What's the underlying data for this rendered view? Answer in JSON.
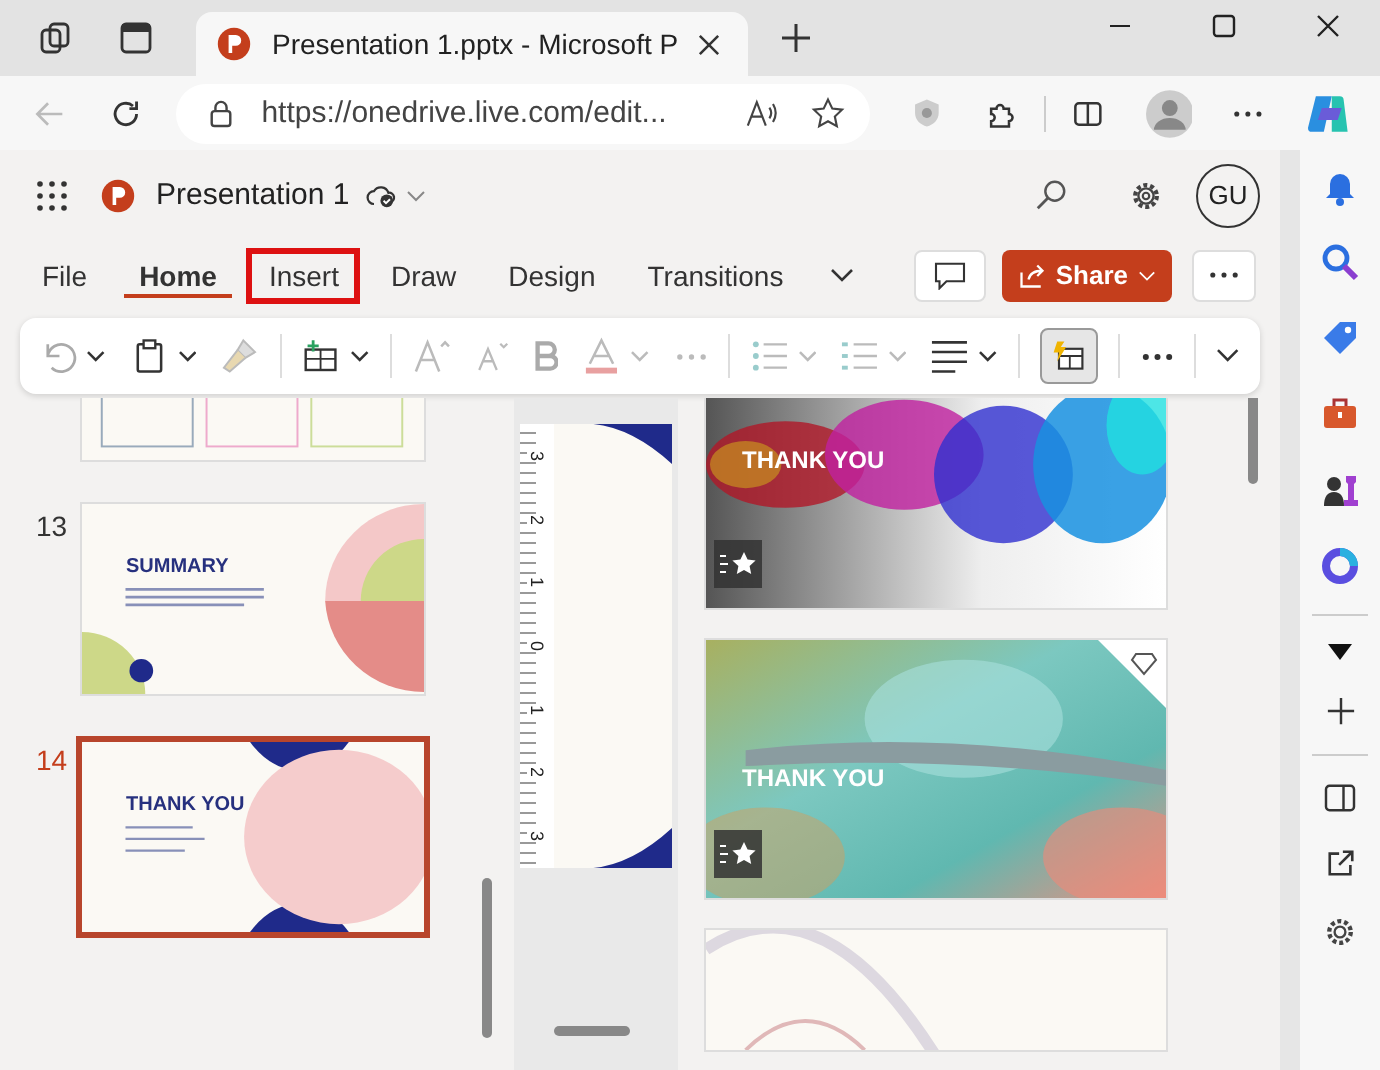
{
  "browser": {
    "tabs": [
      {
        "title": "Presentation 1.pptx - Microsoft P",
        "selected": true
      }
    ],
    "address": "https://onedrive.live.com/edit..."
  },
  "app": {
    "title": "Presentation 1",
    "avatar": "GU",
    "share": "Share"
  },
  "ribbon_tabs": [
    {
      "label": "File",
      "selected": false,
      "highlighted": false
    },
    {
      "label": "Home",
      "selected": true,
      "highlighted": false
    },
    {
      "label": "Insert",
      "selected": false,
      "highlighted": true
    },
    {
      "label": "Draw",
      "selected": false,
      "highlighted": false
    },
    {
      "label": "Design",
      "selected": false,
      "highlighted": false
    },
    {
      "label": "Transitions",
      "selected": false,
      "highlighted": false
    }
  ],
  "slides": [
    {
      "kind": "cards",
      "selected": false
    },
    {
      "kind": "summary",
      "number": "13",
      "title": "SUMMARY",
      "selected": false
    },
    {
      "kind": "thanks",
      "number": "14",
      "title": "THANK YOU",
      "selected": true
    }
  ],
  "ruler": [
    "3",
    "2",
    "1",
    "0",
    "1",
    "2",
    "3"
  ],
  "designs": [
    {
      "kind": "smoke",
      "title": "THANK YOU",
      "premium": false
    },
    {
      "kind": "teal",
      "title": "THANK YOU",
      "premium": true
    },
    {
      "kind": "plain",
      "premium": false
    }
  ]
}
